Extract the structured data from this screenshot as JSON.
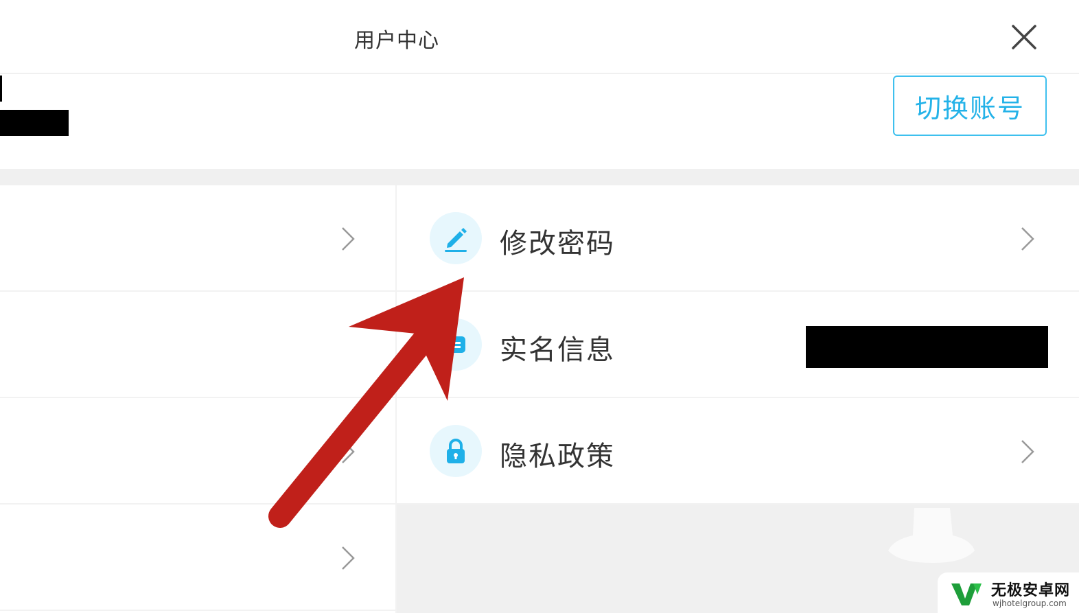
{
  "header": {
    "title": "用户中心"
  },
  "account": {
    "switch_label": "切换账号"
  },
  "menu_right": [
    {
      "label": "修改密码",
      "icon": "pencil-icon"
    },
    {
      "label": "实名信息",
      "icon": "id-card-icon"
    },
    {
      "label": "隐私政策",
      "icon": "lock-icon"
    }
  ],
  "watermark": {
    "text": "无极安卓网",
    "url": "wjhotelgroup.com"
  },
  "colors": {
    "accent": "#23b2e8",
    "annotation_arrow": "#c0201a",
    "background_gray": "#f0f0f0"
  }
}
